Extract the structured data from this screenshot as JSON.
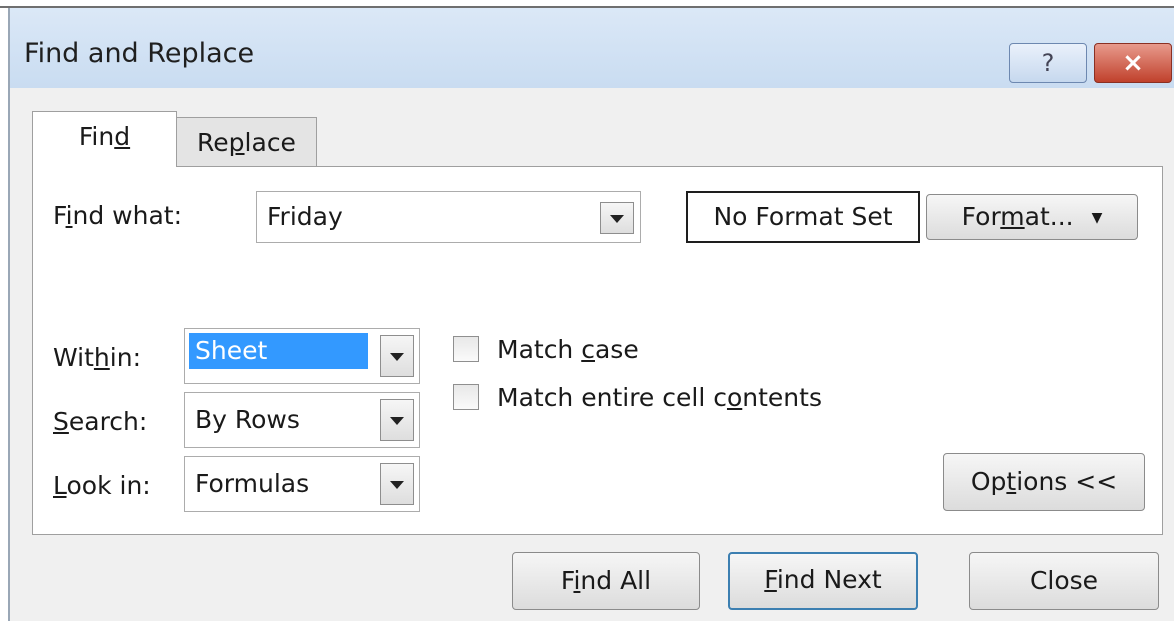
{
  "window": {
    "title": "Find and Replace",
    "help_label": "?",
    "close_label": "×"
  },
  "tabs": [
    {
      "label": "Find",
      "underline_index": 3,
      "active": true
    },
    {
      "label": "Replace",
      "underline_index": 2,
      "active": false
    }
  ],
  "find_what": {
    "label": "Find what:",
    "underline_index": 1,
    "value": "Friday"
  },
  "format_status": "No Format Set",
  "format_button": {
    "label": "Format...",
    "underline_index": 3
  },
  "within": {
    "label": "Within:",
    "underline_index": 3,
    "value": "Sheet"
  },
  "search": {
    "label": "Search:",
    "underline_index": 0,
    "value": "By Rows"
  },
  "look_in": {
    "label": "Look in:",
    "underline_index": 0,
    "value": "Formulas"
  },
  "options": {
    "match_case": {
      "label": "Match case",
      "underline_index": 6,
      "checked": false
    },
    "match_entire": {
      "label": "Match entire cell contents",
      "underline_index": 19,
      "checked": false
    }
  },
  "options_button": {
    "label": "Options <<",
    "underline_index": 2
  },
  "footer": {
    "find_all": {
      "label": "Find All",
      "underline_index": 1
    },
    "find_next": {
      "label": "Find Next",
      "underline_index": 0
    },
    "close": {
      "label": "Close"
    }
  }
}
